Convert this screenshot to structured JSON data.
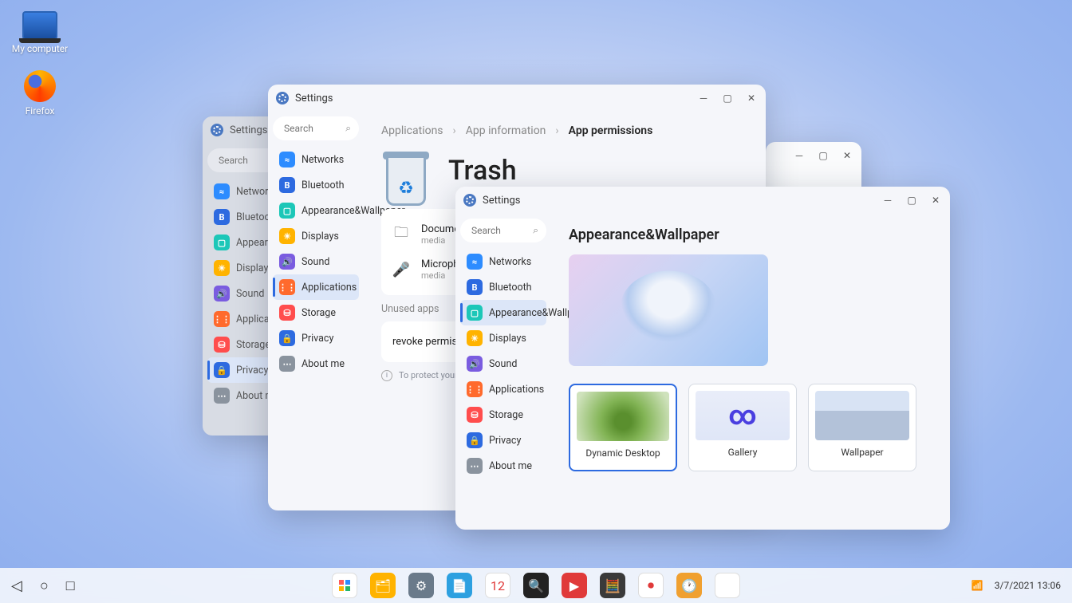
{
  "desktop": {
    "computer_label": "My computer",
    "firefox_label": "Firefox"
  },
  "win_back": {
    "title": "Settings",
    "search_ph": "Search",
    "items": [
      "Networks",
      "Bluetooth",
      "Appearance&Wallpaper",
      "Displays",
      "Sound",
      "Applications",
      "Storage",
      "Privacy",
      "About me"
    ]
  },
  "win_mid": {
    "title": "Settings",
    "search_ph": "Search",
    "nav": [
      "Networks",
      "Bluetooth",
      "Appearance&Wallpaper",
      "Displays",
      "Sound",
      "Applications",
      "Storage",
      "Privacy",
      "About me"
    ],
    "crumbs": {
      "a": "Applications",
      "b": "App information",
      "c": "App permissions"
    },
    "page_title": "Trash",
    "rows": [
      {
        "label": "Documents",
        "sub": "media"
      },
      {
        "label": "Microphone",
        "sub": "media"
      }
    ],
    "unused_lbl": "Unused apps",
    "revoke_lbl": "revoke permissions",
    "footnote": "To protect your data, permissions for Files & Media will be revoked."
  },
  "win_front": {
    "title": "Settings",
    "search_ph": "Search",
    "nav": [
      "Networks",
      "Bluetooth",
      "Appearance&Wallpaper",
      "Displays",
      "Sound",
      "Applications",
      "Storage",
      "Privacy",
      "About me"
    ],
    "page_title": "Appearance&Wallpaper",
    "tiles": [
      {
        "label": "Dynamic Desktop"
      },
      {
        "label": "Gallery"
      },
      {
        "label": "Wallpaper"
      }
    ]
  },
  "taskbar": {
    "datetime": "3/7/2021 13:06"
  },
  "navicons": [
    {
      "c": "c-blue",
      "g": "≈"
    },
    {
      "c": "c-blue2",
      "g": "B"
    },
    {
      "c": "c-teal",
      "g": "▢"
    },
    {
      "c": "c-amber",
      "g": "☀"
    },
    {
      "c": "c-purple",
      "g": "🔊"
    },
    {
      "c": "c-orange",
      "g": "⋮⋮"
    },
    {
      "c": "c-red",
      "g": "⛁"
    },
    {
      "c": "c-blue2",
      "g": "🔒"
    },
    {
      "c": "c-gray",
      "g": "⋯"
    }
  ]
}
